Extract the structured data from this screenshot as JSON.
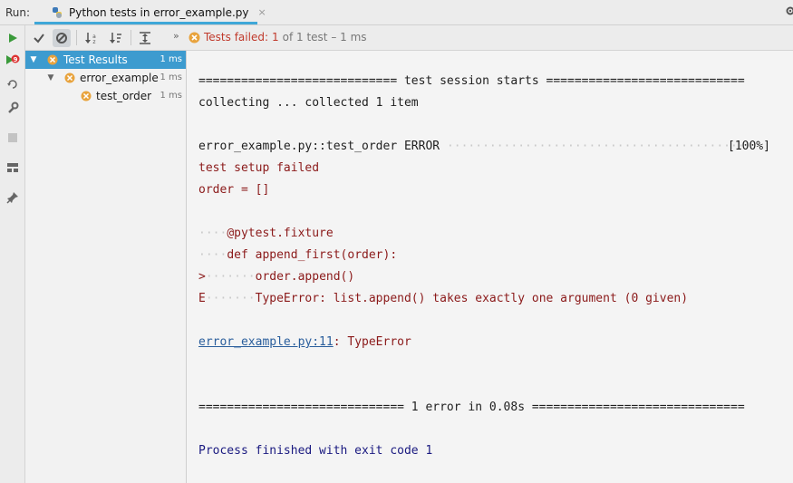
{
  "titlebar": {
    "run_label": "Run:",
    "tab_title": "Python tests in error_example.py",
    "tab_close": "×"
  },
  "testbar": {
    "more_glyph": "»",
    "status_failed": "Tests failed:",
    "status_count": "1",
    "status_rest": "of 1 test – 1 ms"
  },
  "tree": {
    "items": [
      {
        "label": "Test Results",
        "time": "1 ms",
        "state": "error",
        "expanded": true
      },
      {
        "label": "error_example",
        "time": "1 ms",
        "state": "error",
        "expanded": true
      },
      {
        "label": "test_order",
        "time": "1 ms",
        "state": "error"
      }
    ]
  },
  "console": {
    "session_start": "============================ test session starts ============================",
    "collecting": "collecting ... collected 1 item",
    "test_name": "error_example.py::test_order ERROR",
    "test_dots": "···········································",
    "test_percent": "[100%]",
    "setup_failed": "test setup failed",
    "order_line": "order = []",
    "fixture_line": "@pytest.fixture",
    "def_line": "def append_first(order):",
    "append_marker": ">",
    "append_line": "order.append()",
    "error_marker": "E",
    "error_line": "TypeError: list.append() takes exactly one argument (0 given)",
    "link_text": "error_example.py:11",
    "link_suffix": ": TypeError",
    "summary": "============================= 1 error in 0.08s ==============================",
    "process_finished": "Process finished with exit code 1"
  },
  "colors": {
    "accent": "#3d9bcf",
    "error_icon": "#e8a33d",
    "error_text": "#8b1a1a",
    "run_green": "#3a9a3a"
  }
}
